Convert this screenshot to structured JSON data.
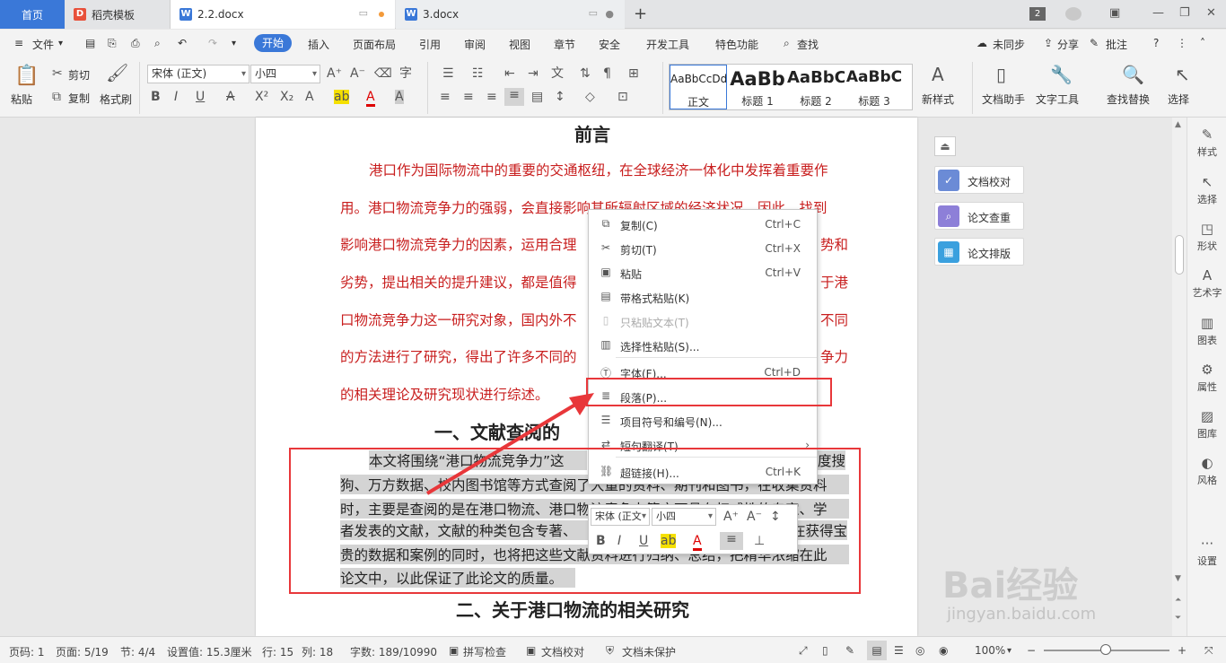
{
  "tabs": {
    "home": "首页",
    "daoke": "稻壳模板",
    "doc1": "2.2.docx",
    "doc2": "3.docx",
    "badge": "2"
  },
  "menu": {
    "file": "文件",
    "start": "开始",
    "insert": "插入",
    "layout": "页面布局",
    "reference": "引用",
    "review": "审阅",
    "view": "视图",
    "chapter": "章节",
    "security": "安全",
    "devtools": "开发工具",
    "special": "特色功能",
    "search": "查找",
    "sync": "未同步",
    "share": "分享",
    "annotate": "批注"
  },
  "ribbon": {
    "paste": "粘贴",
    "cut": "剪切",
    "copy": "复制",
    "format_brush": "格式刷",
    "font_name": "宋体 (正文)",
    "font_size": "小四",
    "styles": [
      {
        "preview": "AaBbCcDd",
        "label": "正文"
      },
      {
        "preview": "AaBb",
        "label": "标题 1"
      },
      {
        "preview": "AaBbC",
        "label": "标题 2"
      },
      {
        "preview": "AaBbC",
        "label": "标题 3"
      }
    ],
    "new_style": "新样式",
    "doc_assistant": "文档助手",
    "text_tools": "文字工具",
    "find_replace": "查找替换",
    "select": "选择"
  },
  "document": {
    "title": "前言",
    "red_lines": [
      "港口作为国际物流中的重要的交通枢纽，在全球经济一体化中发挥着重要作",
      "用。港口物流竞争力的强弱，会直接影响其所辐射区域的经济状况，因此，找到",
      "影响港口物流竞争力的因素，运用合理",
      "劣势，提出相关的提升建议，都是值得",
      "口物流竞争力这一研究对象，国内外不",
      "的方法进行了研究，得出了许多不同的",
      "的相关理论及研究现状进行综述。"
    ],
    "red_right": [
      "势和",
      "于港",
      "不同",
      "争力"
    ],
    "heading1": "一、文献查阅的",
    "body_lines": [
      "本文将围绕“港口物流竞争力”这",
      "狗、万方数据、校内图书馆等方式查阅了大量的资料、期刊和图书，在收集资料",
      "时，主要是查阅的是在港口物流、港口物流竞争力等方面具有权威性的专家、学",
      "者发表的文献，文献的种类包含专著、",
      "贵的数据和案例的同时，也将把这些文献资料进行归纳、总结，把精华浓缩在此",
      "论文中，以此保证了此论文的质量。"
    ],
    "body_right": [
      "度搜",
      "在获得宝"
    ],
    "heading2": "二、关于港口物流的相关研究"
  },
  "context_menu": {
    "items": [
      {
        "label": "复制(C)",
        "shortcut": "Ctrl+C"
      },
      {
        "label": "剪切(T)",
        "shortcut": "Ctrl+X"
      },
      {
        "label": "粘贴",
        "shortcut": "Ctrl+V"
      },
      {
        "label": "带格式粘贴(K)",
        "shortcut": ""
      },
      {
        "label": "只粘贴文本(T)",
        "shortcut": ""
      },
      {
        "label": "选择性粘贴(S)...",
        "shortcut": ""
      },
      {
        "label": "字体(F)...",
        "shortcut": "Ctrl+D"
      },
      {
        "label": "段落(P)...",
        "shortcut": ""
      },
      {
        "label": "项目符号和编号(N)...",
        "shortcut": ""
      },
      {
        "label": "短句翻译(T)",
        "shortcut": ""
      },
      {
        "label": "超链接(H)...",
        "shortcut": "Ctrl+K"
      }
    ]
  },
  "mini_toolbar": {
    "font_name": "宋体 (正文",
    "font_size": "小四"
  },
  "right_panel": {
    "proofread": "文档校对",
    "check": "论文查重",
    "layout": "论文排版"
  },
  "sidebar": {
    "items": [
      "样式",
      "选择",
      "形状",
      "艺术字",
      "图表",
      "属性",
      "图库",
      "风格",
      "设置"
    ]
  },
  "status": {
    "page_no": "页码: 1",
    "page": "页面: 5/19",
    "section": "节: 4/4",
    "setting": "设置值: 15.3厘米",
    "row": "行: 15",
    "col": "列: 18",
    "words": "字数: 189/10990",
    "spell": "拼写检查",
    "proof": "文档校对",
    "protect": "文档未保护",
    "zoom": "100%"
  },
  "watermark": {
    "text": "Bai经验",
    "url": "jingyan.baidu.com"
  },
  "colors": {
    "accent": "#3a78d8",
    "annotation": "#e8373a",
    "doc_red": "#c81e1e"
  }
}
